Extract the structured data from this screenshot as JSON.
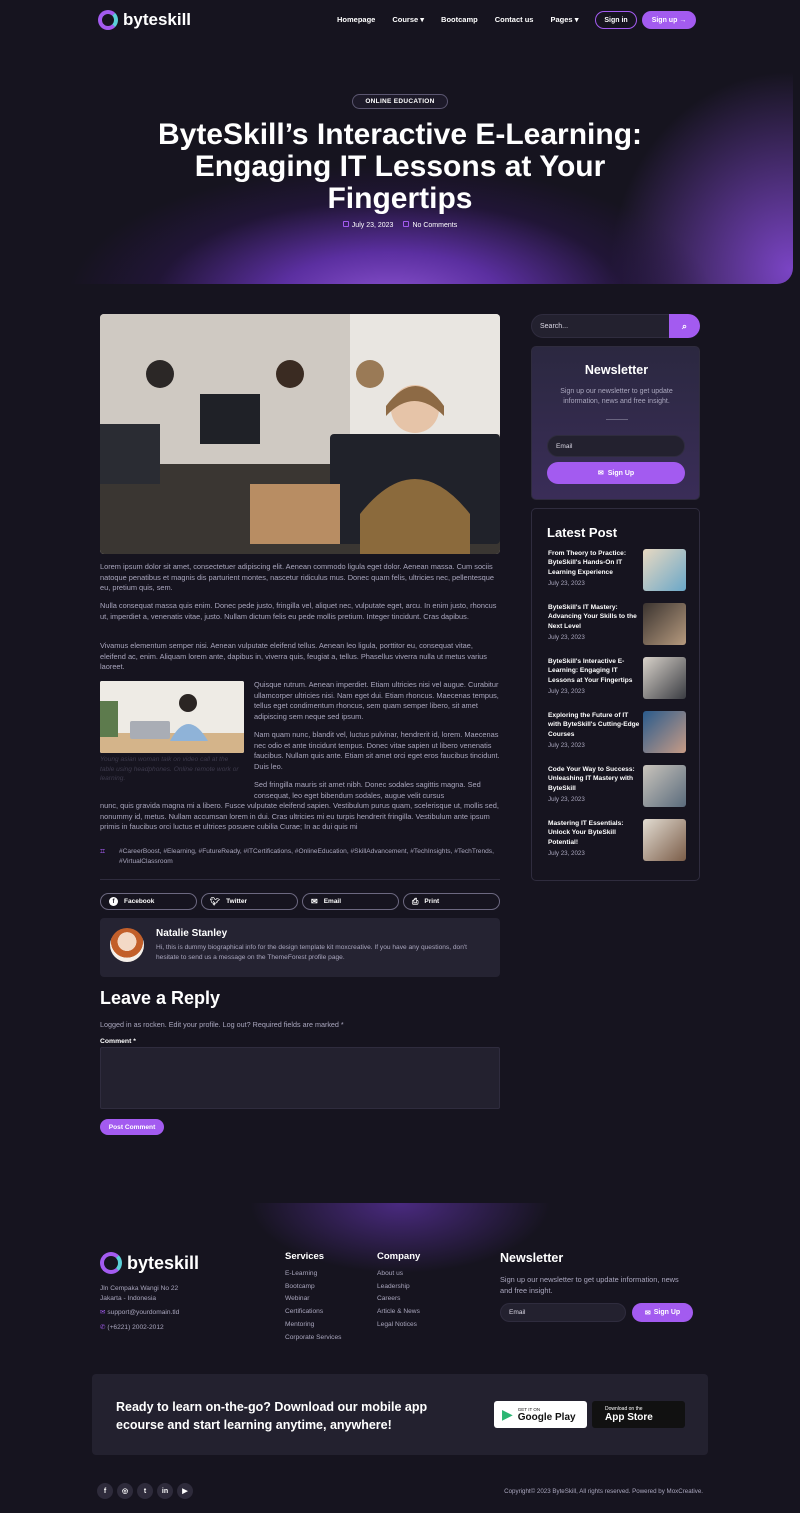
{
  "header": {
    "brand": "byteskill",
    "nav": [
      "Homepage",
      "Course",
      "Bootcamp",
      "Contact us",
      "Pages"
    ],
    "signin": "Sign in",
    "signup": "Sign up"
  },
  "hero": {
    "category": "ONLINE EDUCATION",
    "title_lines": [
      "ByteSkill’s Interactive E-Learning:",
      "Engaging IT Lessons at Your",
      "Fingertips"
    ],
    "date": "July 23, 2023",
    "comments": "No Comments"
  },
  "article": {
    "p1": "Lorem ipsum dolor sit amet, consectetuer adipiscing elit. Aenean commodo ligula eget dolor. Aenean massa. Cum sociis natoque penatibus et magnis dis parturient montes, nascetur ridiculus mus. Donec quam felis, ultricies nec, pellentesque eu, pretium quis, sem.",
    "p2": "Nulla consequat massa quis enim. Donec pede justo, fringilla vel, aliquet nec, vulputate eget, arcu. In enim justo, rhoncus ut, imperdiet a, venenatis vitae, justo. Nullam dictum felis eu pede mollis pretium. Integer tincidunt. Cras dapibus.",
    "p3": "Vivamus elementum semper nisi. Aenean vulputate eleifend tellus. Aenean leo ligula, porttitor eu, consequat vitae, eleifend ac, enim. Aliquam lorem ante, dapibus in, viverra quis, feugiat a, tellus. Phasellus viverra nulla ut metus varius laoreet.",
    "p4": "Quisque rutrum. Aenean imperdiet. Etiam ultricies nisi vel augue. Curabitur ullamcorper ultricies nisi. Nam eget dui. Etiam rhoncus. Maecenas tempus, tellus eget condimentum rhoncus, sem quam semper libero, sit amet adipiscing sem neque sed ipsum.",
    "p5": "Nam quam nunc, blandit vel, luctus pulvinar, hendrerit id, lorem. Maecenas nec odio et ante tincidunt tempus. Donec vitae sapien ut libero venenatis faucibus. Nullam quis ante. Etiam sit amet orci eget eros faucibus tincidunt. Duis leo.",
    "p6_right": "Sed fringilla mauris sit amet nibh. Donec sodales sagittis magna. Sed consequat, leo eget bibendum sodales, augue velit cursus",
    "p6_full": "nunc, quis gravida magna mi a libero. Fusce vulputate eleifend sapien. Vestibulum purus quam, scelerisque ut, mollis sed, nonummy id, metus. Nullam accumsan lorem in dui. Cras ultricies mi eu turpis hendrerit fringilla. Vestibulum ante ipsum primis in faucibus orci luctus et ultrices posuere cubilia Curae; In ac dui quis mi",
    "caption": "Young asian woman talk on video call at the table using headphones. Online remote work or learning.",
    "tags": "#CareerBoost, #Elearning, #FutureReady, #ITCertifications, #OnlineEducation, #SkillAdvancement, #TechInsights, #TechTrends, #VirtualClassroom"
  },
  "share": [
    "Facebook",
    "Twitter",
    "Email",
    "Print"
  ],
  "author": {
    "name": "Natalie Stanley",
    "bio": "Hi, this is dummy biographical info for the design template kit moxcreative. If you have any questions, don't hesitate to send us a message on the ThemeForest profile page."
  },
  "reply": {
    "heading": "Leave a Reply",
    "logged": "Logged in as rocken. Edit your profile. Log out? Required fields are marked *",
    "comment_label": "Comment *",
    "submit": "Post Comment"
  },
  "sidebar": {
    "search_placeholder": "Search...",
    "newsletter_title": "Newsletter",
    "newsletter_text": "Sign up our newsletter to get update information, news and free insight.",
    "email_placeholder": "Email",
    "signup": "Sign Up",
    "latest_title": "Latest Post",
    "posts": [
      {
        "title": "From Theory to Practice: ByteSkill's Hands-On IT Learning Experience",
        "date": "July 23, 2023"
      },
      {
        "title": "ByteSkill's IT Mastery: Advancing Your Skills to the Next Level",
        "date": "July 23, 2023"
      },
      {
        "title": "ByteSkill's Interactive E-Learning: Engaging IT Lessons at Your Fingertips",
        "date": "July 23, 2023"
      },
      {
        "title": "Exploring the Future of IT with ByteSkill's Cutting-Edge Courses",
        "date": "July 23, 2023"
      },
      {
        "title": "Code Your Way to Success: Unleashing IT Mastery with ByteSkill",
        "date": "July 23, 2023"
      },
      {
        "title": "Mastering IT Essentials: Unlock Your ByteSkill Potential!",
        "date": "July 23, 2023"
      }
    ]
  },
  "footer": {
    "brand": "byteskill",
    "address1": "Jln Cempaka Wangi No 22",
    "address2": "Jakarta - Indonesia",
    "email": "support@yourdomain.tld",
    "phone": "(+6221) 2002-2012",
    "services_title": "Services",
    "services": [
      "E-Learning",
      "Bootcamp",
      "Webinar",
      "Certifications",
      "Mentoring",
      "Corporate Services"
    ],
    "company_title": "Company",
    "company": [
      "About us",
      "Leadership",
      "Careers",
      "Article & News",
      "Legal Notices"
    ],
    "newsletter_title": "Newsletter",
    "newsletter_text": "Sign up our newsletter to get update information, news and free insight.",
    "email_placeholder": "Email",
    "signup": "Sign Up",
    "app_line1": "Ready to learn on-the-go? Download our mobile app",
    "app_line2": "ecourse and start learning anytime, anywhere!",
    "gplay_small": "GET IT ON",
    "gplay_big": "Google Play",
    "appstore_small": "Download on the",
    "appstore_big": "App Store",
    "copyright": "Copyright© 2023 ByteSkill, All rights reserved. Powered by MoxCreative."
  },
  "colors": {
    "accent": "#a35bf0",
    "background": "#16141f",
    "card": "#252332",
    "text_muted": "#a9a6bd"
  }
}
